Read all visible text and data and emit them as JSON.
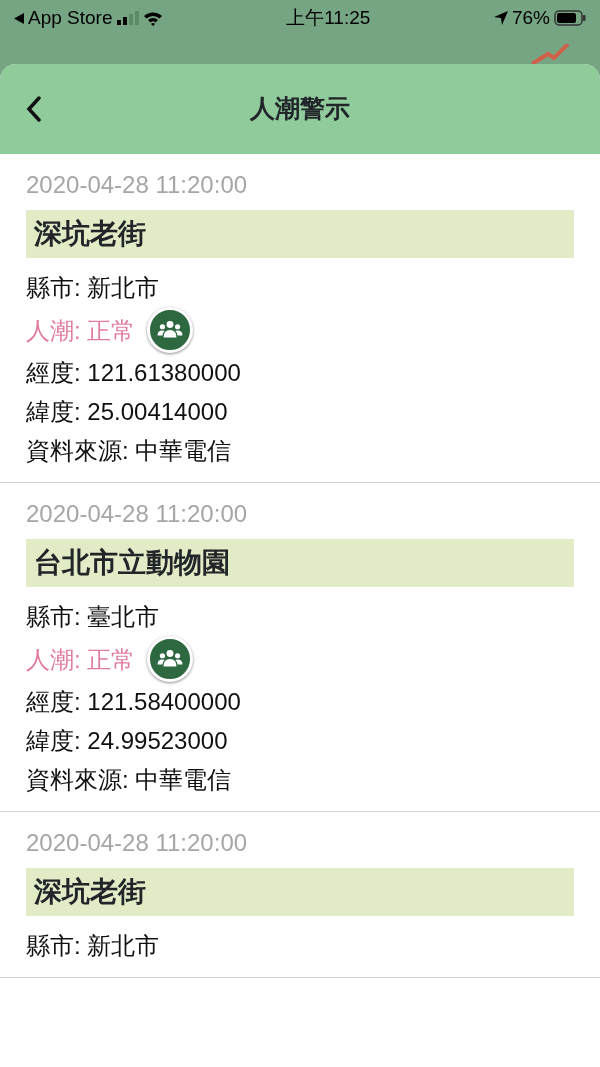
{
  "status_bar": {
    "back_label": "App Store",
    "time": "上午11:25",
    "battery": "76%"
  },
  "header": {
    "title": "人潮警示"
  },
  "records": [
    {
      "time": "2020-04-28 11:20:00",
      "name": "深坑老街",
      "rows": [
        {
          "kind": "plain",
          "text": "縣市: 新北市"
        },
        {
          "kind": "crowd",
          "text": "人潮: 正常"
        },
        {
          "kind": "plain",
          "text": "經度: 121.61380000"
        },
        {
          "kind": "plain",
          "text": "緯度: 25.00414000"
        },
        {
          "kind": "plain",
          "text": "資料來源: 中華電信"
        }
      ]
    },
    {
      "time": "2020-04-28 11:20:00",
      "name": "台北市立動物園",
      "rows": [
        {
          "kind": "plain",
          "text": "縣市: 臺北市"
        },
        {
          "kind": "crowd",
          "text": "人潮: 正常"
        },
        {
          "kind": "plain",
          "text": "經度: 121.58400000"
        },
        {
          "kind": "plain",
          "text": "緯度: 24.99523000"
        },
        {
          "kind": "plain",
          "text": "資料來源: 中華電信"
        }
      ]
    },
    {
      "time": "2020-04-28 11:20:00",
      "name": "深坑老街",
      "rows": [
        {
          "kind": "plain",
          "text": "縣市: 新北市"
        }
      ]
    }
  ]
}
